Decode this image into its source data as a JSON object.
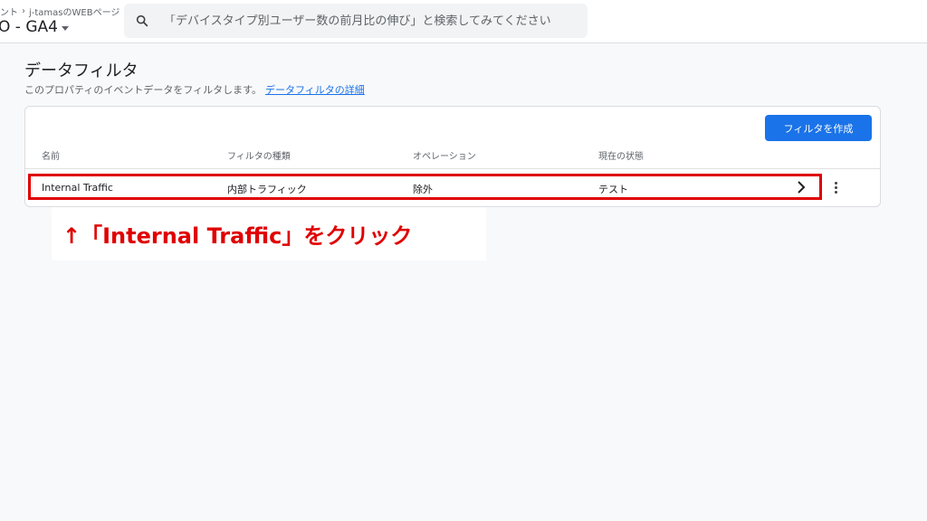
{
  "header": {
    "breadcrumb": [
      "ント",
      "j-tamasのWEBページ"
    ],
    "property_name": "O - GA4"
  },
  "search": {
    "placeholder": "「デバイスタイプ別ユーザー数の前月比の伸び」と検索してみてください"
  },
  "page": {
    "title": "データフィルタ",
    "subtitle": "このプロパティのイベントデータをフィルタします。",
    "subtitle_link": "データフィルタの詳細"
  },
  "table": {
    "create_button": "フィルタを作成",
    "columns": [
      "名前",
      "フィルタの種類",
      "オペレーション",
      "現在の状態"
    ],
    "rows": [
      {
        "name": "Internal Traffic",
        "type": "内部トラフィック",
        "operation": "除外",
        "status": "テスト"
      }
    ]
  },
  "annotation": {
    "text": "↑「Internal Traffic」をクリック",
    "color": "#e00000"
  },
  "colors": {
    "accent": "#1a73e8",
    "highlight": "#e00000"
  },
  "icons": [
    "search-icon",
    "chevron-right-icon",
    "more-vert-icon",
    "caret-down-icon"
  ]
}
